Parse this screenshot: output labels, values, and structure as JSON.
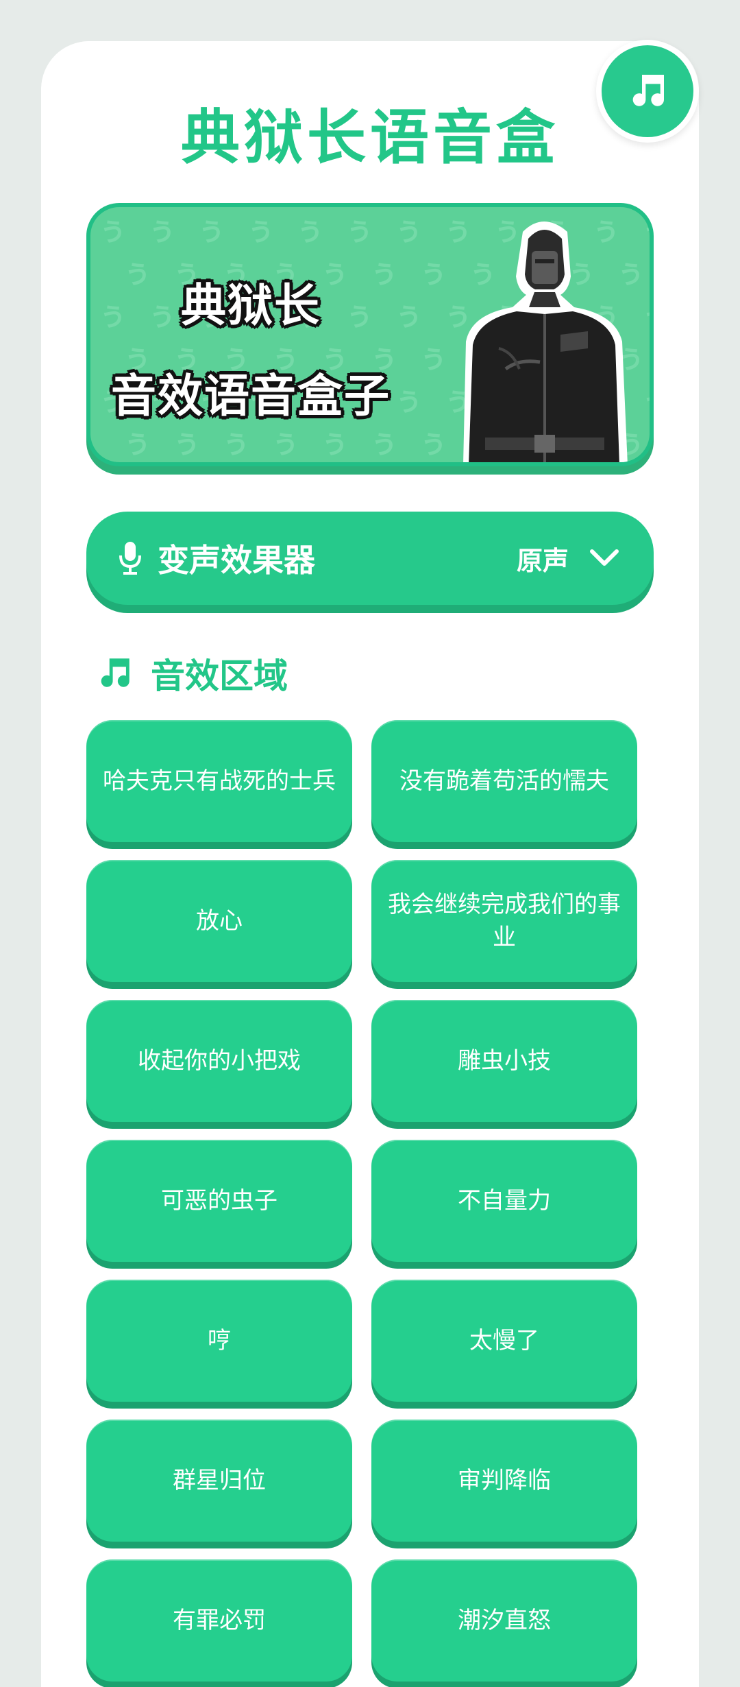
{
  "app": {
    "title": "典狱长语音盒"
  },
  "banner": {
    "line1": "典狱长",
    "line2": "音效语音盒子",
    "pattern_glyph": "ぅ"
  },
  "voice_changer": {
    "label": "变声效果器",
    "value": "原声"
  },
  "sounds_section": {
    "title": "音效区域"
  },
  "sounds": [
    "哈夫克只有战死的士兵",
    "没有跪着苟活的懦夫",
    "放心",
    "我会继续完成我们的事业",
    "收起你的小把戏",
    "雕虫小技",
    "可恶的虫子",
    "不自量力",
    "哼",
    "太慢了",
    "群星归位",
    "审判降临",
    "有罪必罚",
    "潮汐直怒"
  ],
  "colors": {
    "accent": "#22c688",
    "button": "#25cf8e",
    "banner_bg": "#5cd198"
  },
  "icons": {
    "fab": "music-note-icon",
    "voice": "microphone-icon",
    "dropdown": "chevron-down-icon",
    "section": "music-note-icon"
  }
}
